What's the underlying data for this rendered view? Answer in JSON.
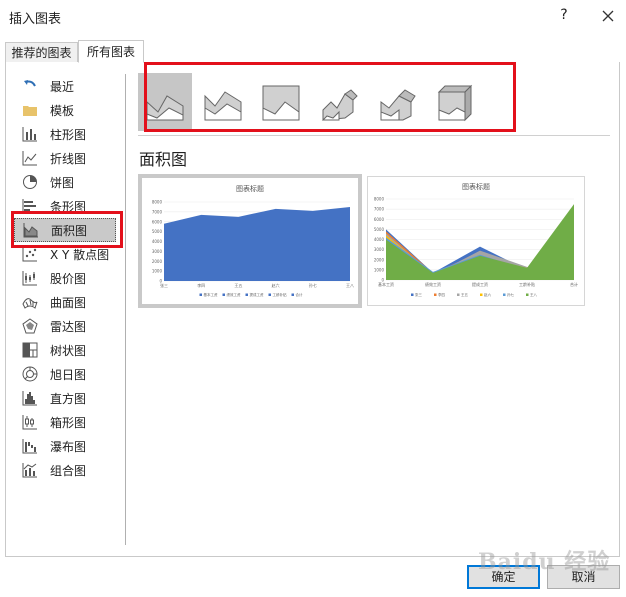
{
  "window": {
    "title": "插入图表",
    "help": "?",
    "close_icon": "close-icon"
  },
  "tabs": [
    {
      "label": "推荐的图表",
      "active": false
    },
    {
      "label": "所有图表",
      "active": true
    }
  ],
  "sidebar": {
    "items": [
      {
        "label": "最近",
        "icon": "undo-icon"
      },
      {
        "label": "模板",
        "icon": "folder-icon"
      },
      {
        "label": "柱形图",
        "icon": "column-chart-icon"
      },
      {
        "label": "折线图",
        "icon": "line-chart-icon"
      },
      {
        "label": "饼图",
        "icon": "pie-chart-icon"
      },
      {
        "label": "条形图",
        "icon": "bar-chart-icon"
      },
      {
        "label": "面积图",
        "icon": "area-chart-icon",
        "selected": true
      },
      {
        "label": "X Y 散点图",
        "icon": "scatter-chart-icon"
      },
      {
        "label": "股价图",
        "icon": "stock-chart-icon"
      },
      {
        "label": "曲面图",
        "icon": "surface-chart-icon"
      },
      {
        "label": "雷达图",
        "icon": "radar-chart-icon"
      },
      {
        "label": "树状图",
        "icon": "treemap-chart-icon"
      },
      {
        "label": "旭日图",
        "icon": "sunburst-chart-icon"
      },
      {
        "label": "直方图",
        "icon": "histogram-chart-icon"
      },
      {
        "label": "箱形图",
        "icon": "box-whisker-chart-icon"
      },
      {
        "label": "瀑布图",
        "icon": "waterfall-chart-icon"
      },
      {
        "label": "组合图",
        "icon": "combo-chart-icon"
      }
    ]
  },
  "subtypes": [
    {
      "icon": "area-icon",
      "selected": true
    },
    {
      "icon": "stacked-area-icon",
      "selected": false
    },
    {
      "icon": "percent-stacked-area-icon",
      "selected": false
    },
    {
      "icon": "3d-area-icon",
      "selected": false
    },
    {
      "icon": "3d-stacked-area-icon",
      "selected": false
    },
    {
      "icon": "3d-percent-stacked-area-icon",
      "selected": false
    }
  ],
  "section_title": "面积图",
  "accent_color": "#4472c4",
  "chart_data": [
    {
      "type": "area",
      "title": "图表标题",
      "categories": [
        "张三",
        "李四",
        "王五",
        "赵六",
        "孙七",
        "王八"
      ],
      "series": [
        {
          "values": [
            5800,
            6700,
            6500,
            7300,
            7100,
            7500
          ]
        }
      ],
      "ylim": [
        0,
        8000
      ],
      "yticks": [
        "0",
        "1000",
        "2000",
        "3000",
        "4000",
        "5000",
        "6000",
        "7000",
        "8000"
      ],
      "legend": [
        "基本工资",
        "绩效工资",
        "提成工资",
        "工龄补贴",
        "合计"
      ],
      "legend_position": "bottom",
      "colors": [
        "#4472c4"
      ]
    },
    {
      "type": "area",
      "title": "图表标题",
      "categories": [
        "基本工资",
        "绩效工资",
        "提成工资",
        "工龄补贴",
        "合计"
      ],
      "series": [
        {
          "name": "张三",
          "values": [
            5000,
            700,
            3300,
            1000,
            0
          ]
        },
        {
          "name": "李四",
          "values": [
            4800,
            700,
            2700,
            1100,
            0
          ]
        },
        {
          "name": "王五",
          "values": [
            4600,
            500,
            2900,
            1300,
            0
          ]
        },
        {
          "name": "赵六",
          "values": [
            4400,
            600,
            2300,
            1200,
            0
          ]
        },
        {
          "name": "孙七",
          "values": [
            4200,
            800,
            2500,
            1000,
            0
          ]
        },
        {
          "name": "王八",
          "values": [
            4000,
            700,
            2400,
            1200,
            7500
          ]
        }
      ],
      "ylim": [
        0,
        8000
      ],
      "yticks": [
        "0",
        "1000",
        "2000",
        "3000",
        "4000",
        "5000",
        "6000",
        "7000",
        "8000"
      ],
      "legend": [
        "张三",
        "李四",
        "王五",
        "赵六",
        "孙七",
        "王八"
      ],
      "legend_position": "bottom",
      "colors": [
        "#4472c4",
        "#ed7d31",
        "#a5a5a5",
        "#ffc000",
        "#5b9bd5",
        "#70ad47"
      ]
    }
  ],
  "buttons": {
    "ok": "确定",
    "cancel": "取消"
  },
  "watermark": "Baidu 经验"
}
